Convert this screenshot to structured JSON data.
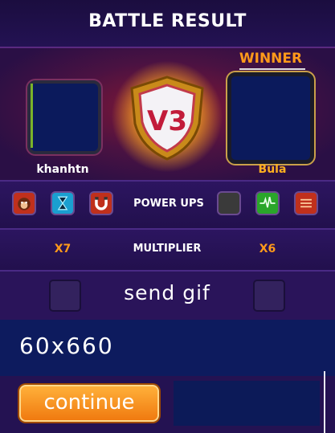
{
  "header": {
    "title": "BATTLE RESULT"
  },
  "players": {
    "left": {
      "name": "khanhtn",
      "multiplier": "X7"
    },
    "right": {
      "name": "Bula",
      "multiplier": "X6",
      "badge": "WINNER"
    }
  },
  "versus_emblem": {
    "text": "V3",
    "icon": "vs-shield-icon"
  },
  "power_ups": {
    "label": "POWER UPS",
    "left": [
      {
        "icon": "monkey-face-icon",
        "color": "#c0301c"
      },
      {
        "icon": "hourglass-icon",
        "color": "#1a9fd0"
      },
      {
        "icon": "magnet-icon",
        "color": "#c0301c"
      }
    ],
    "right": [
      {
        "icon": "empty-slot",
        "color": "#3a3a3a"
      },
      {
        "icon": "heartbeat-icon",
        "color": "#2aa62a"
      },
      {
        "icon": "sliders-icon",
        "color": "#c0301c"
      }
    ]
  },
  "multiplier_row": {
    "label": "MULTIPLIER"
  },
  "gif_row": {
    "label": "send gif"
  },
  "ad_slot": {
    "text": "60x660"
  },
  "footer": {
    "continue_label": "continue"
  }
}
